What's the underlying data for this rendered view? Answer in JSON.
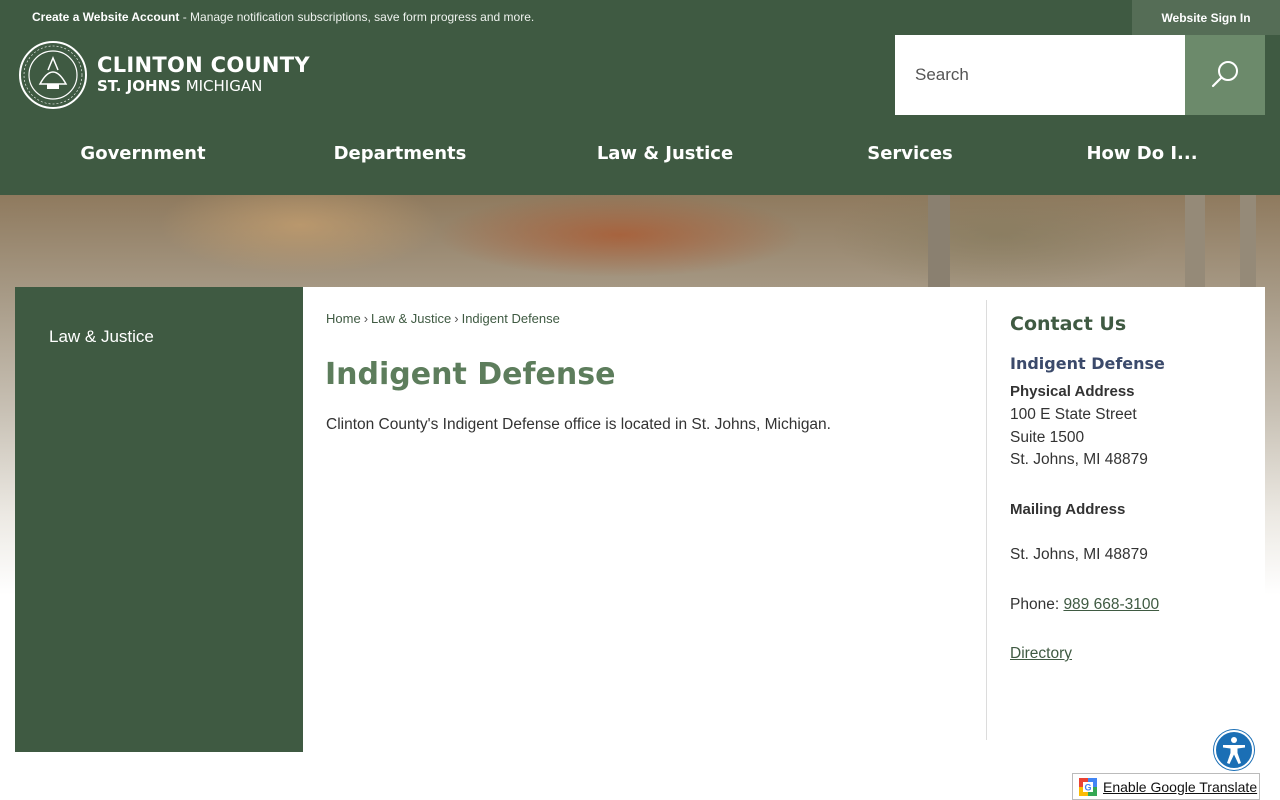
{
  "topbar": {
    "account_link": "Create a Website Account",
    "account_desc": " - Manage notification subscriptions, save form progress and more.",
    "signin_label": "Website Sign In"
  },
  "header": {
    "logo_line1": "CLINTON COUNTY",
    "logo_line2_bold": "ST. JOHNS",
    "logo_line2_rest": " MICHIGAN",
    "search_placeholder": "Search"
  },
  "nav": {
    "items": [
      {
        "label": "Government"
      },
      {
        "label": "Departments"
      },
      {
        "label": "Law & Justice"
      },
      {
        "label": "Services"
      },
      {
        "label": "How Do I..."
      }
    ]
  },
  "sidebar": {
    "items": [
      {
        "label": "Law & Justice"
      }
    ]
  },
  "breadcrumb": {
    "items": [
      "Home",
      "Law & Justice",
      "Indigent Defense"
    ],
    "separator": "›"
  },
  "main": {
    "title": "Indigent Defense",
    "intro": "Clinton County's Indigent Defense office is located in St. Johns, Michigan."
  },
  "contact": {
    "title": "Contact Us",
    "department": "Indigent Defense",
    "physical_label": "Physical Address",
    "physical_line1": "100 E State Street",
    "physical_line2": "Suite 1500",
    "physical_line3": "St. Johns, MI 48879",
    "mailing_label": "Mailing Address",
    "mailing_line1": "St. Johns, MI 48879",
    "phone_label": "Phone: ",
    "phone_value": "989 668-3100",
    "directory_link": "Directory"
  },
  "widgets": {
    "translate_label": "Enable Google Translate",
    "accessibility_icon": "accessibility-icon"
  },
  "colors": {
    "brand_green": "#3f5a42",
    "title_green": "#5d7d5c",
    "search_button": "#6c8a6b",
    "department_blue": "#3b4a6b"
  }
}
